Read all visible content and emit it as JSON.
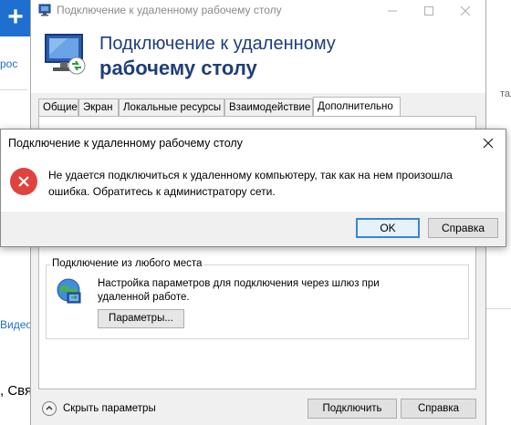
{
  "background": {
    "plus_glyph": "+",
    "ros_text": "рос",
    "vide_text": "Видео",
    "svya_text": ", Свя",
    "right_fragment": "тале"
  },
  "rdp": {
    "window_title": "Подключение к удаленному рабочему столу",
    "header_line1": "Подключение к удаленному",
    "header_line2": "рабочему столу",
    "tabs": [
      {
        "label": "Общие"
      },
      {
        "label": "Экран"
      },
      {
        "label": "Локальные ресурсы"
      },
      {
        "label": "Взаимодействие"
      },
      {
        "label": "Дополнительно"
      }
    ],
    "active_tab": "Дополнительно",
    "gateway_group": {
      "title": "Подключение из любого места",
      "desc_line1": "Настройка параметров для подключения через шлюз при",
      "desc_line2": "удаленной работе.",
      "params_button": "Параметры..."
    },
    "hide_params_label": "Скрыть параметры",
    "connect_button": "Подключить",
    "help_button": "Справка"
  },
  "error_dialog": {
    "title": "Подключение к удаленному рабочему столу",
    "message_line1": "Не удается подключиться к удаленному компьютеру, так как на нем произошла",
    "message_line2": "ошибка. Обратитесь к администратору сети.",
    "ok_button": "OK",
    "help_button": "Справка"
  },
  "colors": {
    "header_text": "#1f3e7a",
    "error_icon": "#e0433d",
    "accent_blue": "#1e6fcf",
    "ok_button_border": "#3b84d6"
  },
  "icons": {
    "title_icon": "remote-desktop-icon",
    "header_logo": "remote-desktop-monitor-icon",
    "gateway_icon": "globe-network-icon",
    "error_icon": "error-x-icon",
    "hide_params_icon": "chevron-up-icon",
    "close_icon": "close-icon"
  }
}
